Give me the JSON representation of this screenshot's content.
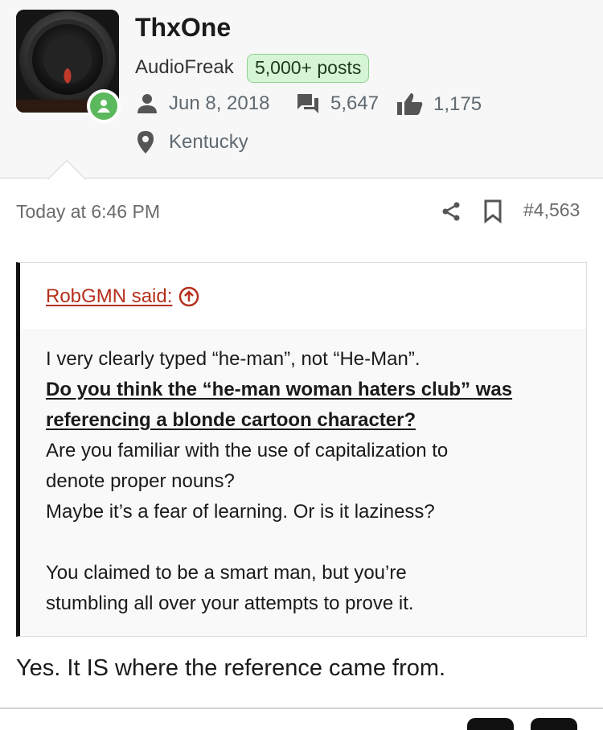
{
  "user": {
    "name": "ThxOne",
    "title": "AudioFreak",
    "badge": "5,000+ posts",
    "joined": "Jun 8, 2018",
    "messages": "5,647",
    "reactions": "1,175",
    "location": "Kentucky",
    "online_status_icon": "person-icon",
    "online_color": "#5cb85c"
  },
  "post": {
    "time": "Today at 6:46 PM",
    "number": "#4,563",
    "reply": "Yes. It IS where the reference came from."
  },
  "quote": {
    "author": "RobGMN said:",
    "lines": [
      "I very clearly typed “he-man”, not “He-Man”.",
      "Do you think the “he-man woman haters club” was",
      "referencing a blonde cartoon character?",
      "Are you familiar with the use of capitalization to",
      "denote proper nouns?",
      "Maybe it’s a fear of learning. Or is it laziness?",
      "You claimed to be a smart man, but you’re",
      "stumbling all over your attempts to prove it."
    ]
  },
  "colors": {
    "quote_author": "#b5301c",
    "badge_bg": "#d6f5d6",
    "badge_border": "#8fd18f"
  }
}
